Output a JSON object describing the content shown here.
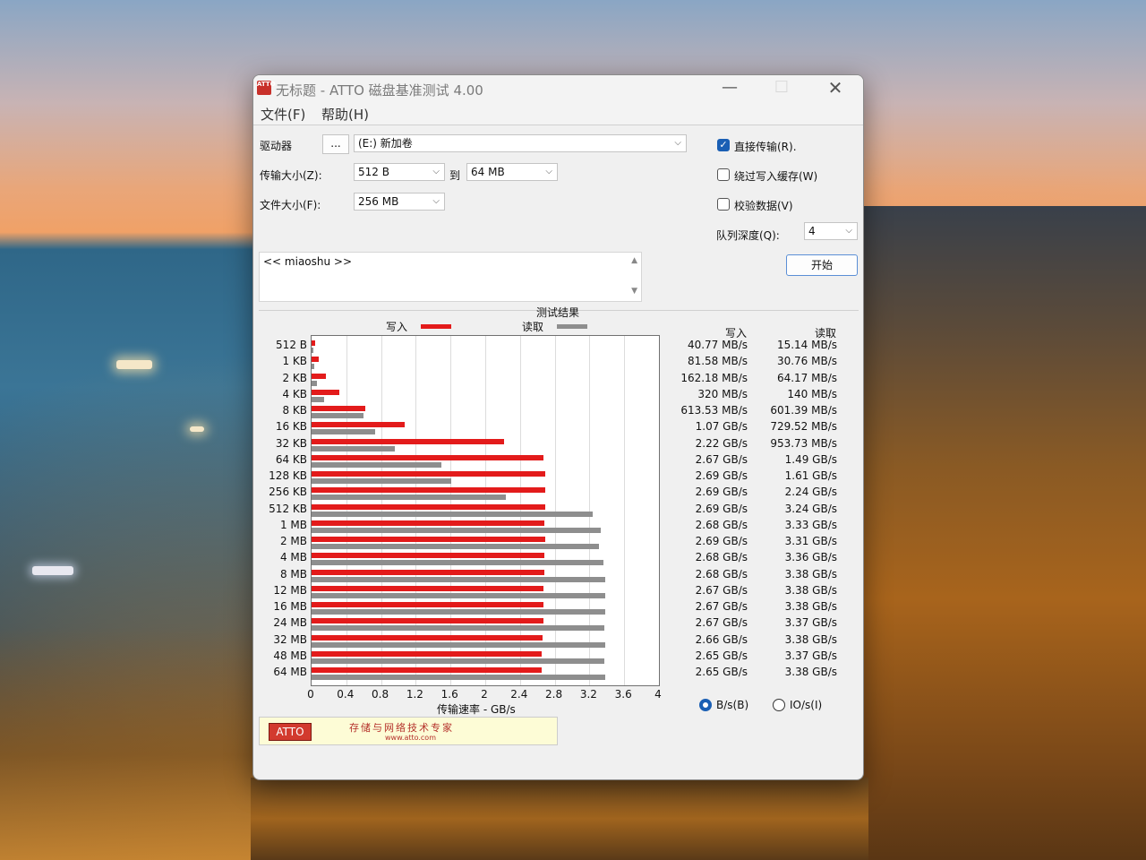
{
  "window": {
    "title": "无标题 - ATTO 磁盘基准测试 4.00",
    "app_icon_text": "ATTO",
    "controls": {
      "minimize": "—",
      "maximize": "☐",
      "close": "✕"
    }
  },
  "menu": {
    "file": "文件(F)",
    "help": "帮助(H)"
  },
  "settings": {
    "drive_label": "驱动器",
    "browse_label": "...",
    "drive_value": "(E:) 新加卷",
    "transfer_size_label": "传输大小(Z):",
    "transfer_from": "512 B",
    "to_label": "到",
    "transfer_to": "64 MB",
    "file_size_label": "文件大小(F):",
    "file_size": "256 MB",
    "direct_io_label": "直接传输(R).",
    "direct_io_checked": true,
    "bypass_cache_label": "绕过写入缓存(W)",
    "bypass_cache_checked": false,
    "verify_label": "校验数据(V)",
    "verify_checked": false,
    "queue_depth_label": "队列深度(Q):",
    "queue_depth": "4",
    "start_label": "开始",
    "description": "<< miaoshu >>"
  },
  "results": {
    "title": "测试结果",
    "legend_write": "写入",
    "legend_read": "读取",
    "col_write": "写入",
    "col_read": "读取",
    "xaxis_label": "传输速率 - GB/s",
    "unit_bytes": "B/s(B)",
    "unit_io": "IO/s(I)",
    "unit_selected": "B/s(B)",
    "write_color": "#e31b1b",
    "read_color": "#8e8e8e"
  },
  "chart_data": {
    "type": "bar",
    "orientation": "horizontal",
    "title": "测试结果",
    "xlabel": "传输速率 - GB/s",
    "xlim": [
      0,
      4
    ],
    "xticks": [
      "0",
      "0.4",
      "0.8",
      "1.2",
      "1.6",
      "2",
      "2.4",
      "2.8",
      "3.2",
      "3.6",
      "4"
    ],
    "categories": [
      "512 B",
      "1 KB",
      "2 KB",
      "4 KB",
      "8 KB",
      "16 KB",
      "32 KB",
      "64 KB",
      "128 KB",
      "256 KB",
      "512 KB",
      "1 MB",
      "2 MB",
      "4 MB",
      "8 MB",
      "12 MB",
      "16 MB",
      "24 MB",
      "32 MB",
      "48 MB",
      "64 MB"
    ],
    "series": [
      {
        "name": "写入",
        "values": [
          0.04077,
          0.08158,
          0.16218,
          0.32,
          0.61353,
          1.07,
          2.22,
          2.67,
          2.69,
          2.69,
          2.69,
          2.68,
          2.69,
          2.68,
          2.68,
          2.67,
          2.67,
          2.67,
          2.66,
          2.65,
          2.65
        ],
        "labels": [
          "40.77 MB/s",
          "81.58 MB/s",
          "162.18 MB/s",
          "320 MB/s",
          "613.53 MB/s",
          "1.07 GB/s",
          "2.22 GB/s",
          "2.67 GB/s",
          "2.69 GB/s",
          "2.69 GB/s",
          "2.69 GB/s",
          "2.68 GB/s",
          "2.69 GB/s",
          "2.68 GB/s",
          "2.68 GB/s",
          "2.67 GB/s",
          "2.67 GB/s",
          "2.67 GB/s",
          "2.66 GB/s",
          "2.65 GB/s",
          "2.65 GB/s"
        ]
      },
      {
        "name": "读取",
        "values": [
          0.01514,
          0.03076,
          0.06417,
          0.14,
          0.60139,
          0.72952,
          0.95373,
          1.49,
          1.61,
          2.24,
          3.24,
          3.33,
          3.31,
          3.36,
          3.38,
          3.38,
          3.38,
          3.37,
          3.38,
          3.37,
          3.38
        ],
        "labels": [
          "15.14 MB/s",
          "30.76 MB/s",
          "64.17 MB/s",
          "140 MB/s",
          "601.39 MB/s",
          "729.52 MB/s",
          "953.73 MB/s",
          "1.49 GB/s",
          "1.61 GB/s",
          "2.24 GB/s",
          "3.24 GB/s",
          "3.33 GB/s",
          "3.31 GB/s",
          "3.36 GB/s",
          "3.38 GB/s",
          "3.38 GB/s",
          "3.38 GB/s",
          "3.37 GB/s",
          "3.38 GB/s",
          "3.37 GB/s",
          "3.38 GB/s"
        ]
      }
    ],
    "grid": true
  },
  "banner": {
    "logo": "ATTO",
    "slogan": "存储与网络技术专家",
    "url": "www.atto.com"
  }
}
